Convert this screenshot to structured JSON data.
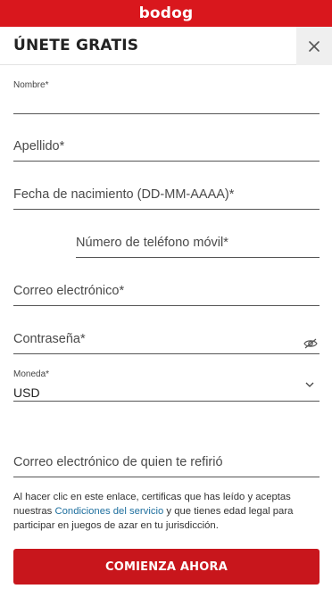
{
  "brand": {
    "logo_text": "bodog",
    "primary_color": "#d9171d"
  },
  "header": {
    "title": "ÚNETE GRATIS",
    "close_icon": "close-icon"
  },
  "form": {
    "first_name_label": "Nombre*",
    "last_name_placeholder": "Apellido*",
    "birthdate_placeholder": "Fecha de nacimiento (DD-MM-AAAA)*",
    "phone_placeholder": "Número de teléfono móvil*",
    "email_placeholder": "Correo electrónico*",
    "password_placeholder": "Contraseña*",
    "password_toggle_icon": "eye-slash-icon",
    "currency_label": "Moneda*",
    "currency_value": "USD",
    "referrer_placeholder": "Correo electrónico de quien te refirió"
  },
  "legal": {
    "text_before": "Al hacer clic en este enlace, certificas que has leído y aceptas nuestras ",
    "link_text": "Condiciones del servicio",
    "text_after": " y que tienes edad legal para participar en juegos de azar en tu jurisdicción.",
    "link_color": "#1e6f9e"
  },
  "cta": {
    "label": "COMIENZA AHORA"
  }
}
